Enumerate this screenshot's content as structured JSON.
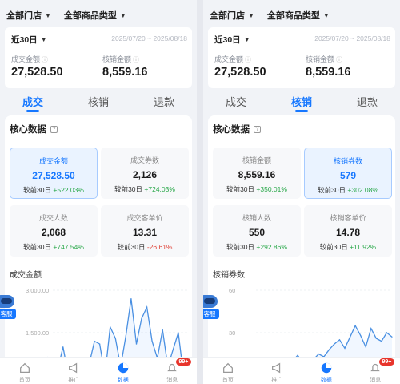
{
  "panels": [
    {
      "filters": {
        "store": "全部门店",
        "category": "全部商品类型"
      },
      "summary": {
        "range_label": "近30日",
        "dates": "2025/07/20 ~ 2025/08/18",
        "metric1": {
          "label": "成交金额",
          "value": "27,528.50"
        },
        "metric2": {
          "label": "核销金额",
          "value": "8,559.16"
        }
      },
      "tabs": [
        {
          "label": "成交",
          "active": true
        },
        {
          "label": "核销",
          "active": false
        },
        {
          "label": "退款",
          "active": false
        }
      ],
      "core_title": "核心数据",
      "cards": [
        {
          "label": "成交金额",
          "value": "27,528.50",
          "compare": "较前30日",
          "change": "+522.03%",
          "dir": "up",
          "selected": true
        },
        {
          "label": "成交券数",
          "value": "2,126",
          "compare": "较前30日",
          "change": "+724.03%",
          "dir": "up",
          "selected": false
        },
        {
          "label": "成交人数",
          "value": "2,068",
          "compare": "较前30日",
          "change": "+747.54%",
          "dir": "up",
          "selected": false
        },
        {
          "label": "成交客单价",
          "value": "13.31",
          "compare": "较前30日",
          "change": "-26.61%",
          "dir": "down",
          "selected": false
        }
      ],
      "chart_title": "成交金额",
      "chart_data": {
        "type": "line",
        "y_ticks": [
          "3,000.00",
          "1,500.00"
        ],
        "ylim": [
          0,
          3000
        ],
        "values": [
          0,
          0,
          600,
          0,
          200,
          1000,
          0,
          0,
          100,
          0,
          400,
          1200,
          1100,
          0,
          1700,
          1300,
          300,
          1400,
          2700,
          1100,
          2000,
          2400,
          1200,
          600,
          1600,
          300,
          900,
          1500,
          0,
          500
        ]
      },
      "tabbar": [
        {
          "label": "首页",
          "icon": "home-icon",
          "active": false
        },
        {
          "label": "推广",
          "icon": "megaphone-icon",
          "active": false
        },
        {
          "label": "数据",
          "icon": "pie-chart-icon",
          "active": true
        },
        {
          "label": "消息",
          "icon": "bell-icon",
          "active": false,
          "badge": "99+"
        }
      ],
      "cs_label": "客服"
    },
    {
      "filters": {
        "store": "全部门店",
        "category": "全部商品类型"
      },
      "summary": {
        "range_label": "近30日",
        "dates": "2025/07/20 ~ 2025/08/18",
        "metric1": {
          "label": "成交金额",
          "value": "27,528.50"
        },
        "metric2": {
          "label": "核销金额",
          "value": "8,559.16"
        }
      },
      "tabs": [
        {
          "label": "成交",
          "active": false
        },
        {
          "label": "核销",
          "active": true
        },
        {
          "label": "退款",
          "active": false
        }
      ],
      "core_title": "核心数据",
      "cards": [
        {
          "label": "核销金额",
          "value": "8,559.16",
          "compare": "较前30日",
          "change": "+350.01%",
          "dir": "up",
          "selected": false
        },
        {
          "label": "核销券数",
          "value": "579",
          "compare": "较前30日",
          "change": "+302.08%",
          "dir": "up",
          "selected": true
        },
        {
          "label": "核销人数",
          "value": "550",
          "compare": "较前30日",
          "change": "+292.86%",
          "dir": "up",
          "selected": false
        },
        {
          "label": "核销客单价",
          "value": "14.78",
          "compare": "较前30日",
          "change": "+11.92%",
          "dir": "up",
          "selected": false
        }
      ],
      "chart_title": "核销券数",
      "chart_data": {
        "type": "line",
        "y_ticks": [
          "60",
          "30"
        ],
        "ylim": [
          0,
          60
        ],
        "values": [
          0,
          2,
          5,
          3,
          4,
          6,
          2,
          8,
          12,
          5,
          10,
          14,
          9,
          6,
          11,
          15,
          13,
          18,
          22,
          25,
          19,
          27,
          35,
          28,
          20,
          33,
          26,
          24,
          30,
          27
        ]
      },
      "tabbar": [
        {
          "label": "首页",
          "icon": "home-icon",
          "active": false
        },
        {
          "label": "推广",
          "icon": "megaphone-icon",
          "active": false
        },
        {
          "label": "数据",
          "icon": "pie-chart-icon",
          "active": true
        },
        {
          "label": "消息",
          "icon": "bell-icon",
          "active": false,
          "badge": "99+"
        }
      ],
      "cs_label": "客服"
    }
  ]
}
